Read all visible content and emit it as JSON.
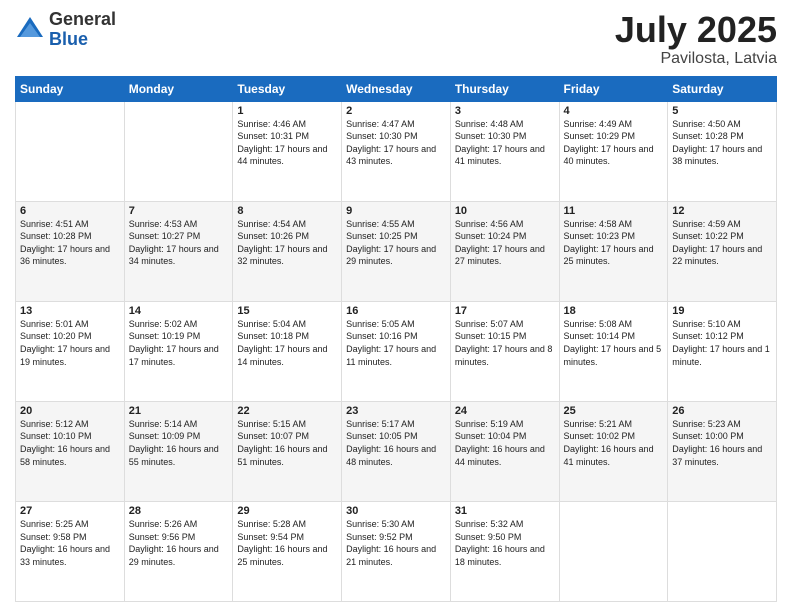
{
  "header": {
    "logo": {
      "general": "General",
      "blue": "Blue"
    },
    "title": "July 2025",
    "location": "Pavilosta, Latvia"
  },
  "weekdays": [
    "Sunday",
    "Monday",
    "Tuesday",
    "Wednesday",
    "Thursday",
    "Friday",
    "Saturday"
  ],
  "weeks": [
    [
      null,
      null,
      {
        "day": 1,
        "sunrise": "4:46 AM",
        "sunset": "10:31 PM",
        "daylight": "17 hours and 44 minutes."
      },
      {
        "day": 2,
        "sunrise": "4:47 AM",
        "sunset": "10:30 PM",
        "daylight": "17 hours and 43 minutes."
      },
      {
        "day": 3,
        "sunrise": "4:48 AM",
        "sunset": "10:30 PM",
        "daylight": "17 hours and 41 minutes."
      },
      {
        "day": 4,
        "sunrise": "4:49 AM",
        "sunset": "10:29 PM",
        "daylight": "17 hours and 40 minutes."
      },
      {
        "day": 5,
        "sunrise": "4:50 AM",
        "sunset": "10:28 PM",
        "daylight": "17 hours and 38 minutes."
      }
    ],
    [
      {
        "day": 6,
        "sunrise": "4:51 AM",
        "sunset": "10:28 PM",
        "daylight": "17 hours and 36 minutes."
      },
      {
        "day": 7,
        "sunrise": "4:53 AM",
        "sunset": "10:27 PM",
        "daylight": "17 hours and 34 minutes."
      },
      {
        "day": 8,
        "sunrise": "4:54 AM",
        "sunset": "10:26 PM",
        "daylight": "17 hours and 32 minutes."
      },
      {
        "day": 9,
        "sunrise": "4:55 AM",
        "sunset": "10:25 PM",
        "daylight": "17 hours and 29 minutes."
      },
      {
        "day": 10,
        "sunrise": "4:56 AM",
        "sunset": "10:24 PM",
        "daylight": "17 hours and 27 minutes."
      },
      {
        "day": 11,
        "sunrise": "4:58 AM",
        "sunset": "10:23 PM",
        "daylight": "17 hours and 25 minutes."
      },
      {
        "day": 12,
        "sunrise": "4:59 AM",
        "sunset": "10:22 PM",
        "daylight": "17 hours and 22 minutes."
      }
    ],
    [
      {
        "day": 13,
        "sunrise": "5:01 AM",
        "sunset": "10:20 PM",
        "daylight": "17 hours and 19 minutes."
      },
      {
        "day": 14,
        "sunrise": "5:02 AM",
        "sunset": "10:19 PM",
        "daylight": "17 hours and 17 minutes."
      },
      {
        "day": 15,
        "sunrise": "5:04 AM",
        "sunset": "10:18 PM",
        "daylight": "17 hours and 14 minutes."
      },
      {
        "day": 16,
        "sunrise": "5:05 AM",
        "sunset": "10:16 PM",
        "daylight": "17 hours and 11 minutes."
      },
      {
        "day": 17,
        "sunrise": "5:07 AM",
        "sunset": "10:15 PM",
        "daylight": "17 hours and 8 minutes."
      },
      {
        "day": 18,
        "sunrise": "5:08 AM",
        "sunset": "10:14 PM",
        "daylight": "17 hours and 5 minutes."
      },
      {
        "day": 19,
        "sunrise": "5:10 AM",
        "sunset": "10:12 PM",
        "daylight": "17 hours and 1 minute."
      }
    ],
    [
      {
        "day": 20,
        "sunrise": "5:12 AM",
        "sunset": "10:10 PM",
        "daylight": "16 hours and 58 minutes."
      },
      {
        "day": 21,
        "sunrise": "5:14 AM",
        "sunset": "10:09 PM",
        "daylight": "16 hours and 55 minutes."
      },
      {
        "day": 22,
        "sunrise": "5:15 AM",
        "sunset": "10:07 PM",
        "daylight": "16 hours and 51 minutes."
      },
      {
        "day": 23,
        "sunrise": "5:17 AM",
        "sunset": "10:05 PM",
        "daylight": "16 hours and 48 minutes."
      },
      {
        "day": 24,
        "sunrise": "5:19 AM",
        "sunset": "10:04 PM",
        "daylight": "16 hours and 44 minutes."
      },
      {
        "day": 25,
        "sunrise": "5:21 AM",
        "sunset": "10:02 PM",
        "daylight": "16 hours and 41 minutes."
      },
      {
        "day": 26,
        "sunrise": "5:23 AM",
        "sunset": "10:00 PM",
        "daylight": "16 hours and 37 minutes."
      }
    ],
    [
      {
        "day": 27,
        "sunrise": "5:25 AM",
        "sunset": "9:58 PM",
        "daylight": "16 hours and 33 minutes."
      },
      {
        "day": 28,
        "sunrise": "5:26 AM",
        "sunset": "9:56 PM",
        "daylight": "16 hours and 29 minutes."
      },
      {
        "day": 29,
        "sunrise": "5:28 AM",
        "sunset": "9:54 PM",
        "daylight": "16 hours and 25 minutes."
      },
      {
        "day": 30,
        "sunrise": "5:30 AM",
        "sunset": "9:52 PM",
        "daylight": "16 hours and 21 minutes."
      },
      {
        "day": 31,
        "sunrise": "5:32 AM",
        "sunset": "9:50 PM",
        "daylight": "16 hours and 18 minutes."
      },
      null,
      null
    ]
  ]
}
